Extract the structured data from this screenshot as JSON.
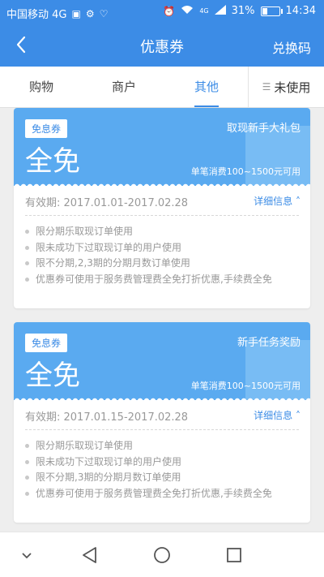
{
  "status_bar": {
    "carrier": "中国移动 4G",
    "network_4g": "4G",
    "battery_percent": "31%",
    "time": "14:34",
    "battery_level": 0.31
  },
  "header": {
    "title": "优惠券",
    "action_label": "兑换码"
  },
  "tabs": [
    {
      "label": "购物",
      "active": false
    },
    {
      "label": "商户",
      "active": false
    },
    {
      "label": "其他",
      "active": true
    }
  ],
  "filter": {
    "label": "未使用"
  },
  "coupons": [
    {
      "tag": "免息券",
      "name": "取现新手大礼包",
      "big_text": "全免",
      "condition": "单笔消费100~1500元可用",
      "validity": "有效期: 2017.01.01-2017.02.28",
      "detail_label": "详细信息",
      "rules": [
        "限分期乐取现订单使用",
        "限未成功下过取现订单的用户使用",
        "限不分期,2,3期的分期月数订单使用",
        "优惠券可使用于服务费管理费全免打折优惠,手续费全免"
      ]
    },
    {
      "tag": "免息券",
      "name": "新手任务奖励",
      "big_text": "全免",
      "condition": "单笔消费100~1500元可用",
      "validity": "有效期: 2017.01.15-2017.02.28",
      "detail_label": "详细信息",
      "rules": [
        "限分期乐取现订单使用",
        "限未成功下过取现订单的用户使用",
        "限不分期,3期的分期月数订单使用",
        "优惠券可使用于服务费管理费全免打折优惠,手续费全免"
      ]
    }
  ],
  "colors": {
    "primary": "#3c8ce6",
    "coupon_bg": "#5aaaf0",
    "text_muted": "#999999"
  },
  "icons": {
    "back": "back-arrow-icon",
    "filter": "filter-icon",
    "detail": "chevron-up-icon",
    "nav_down": "chevron-down-icon",
    "nav_back": "triangle-back-icon",
    "nav_home": "circle-home-icon",
    "nav_recent": "square-recent-icon"
  }
}
